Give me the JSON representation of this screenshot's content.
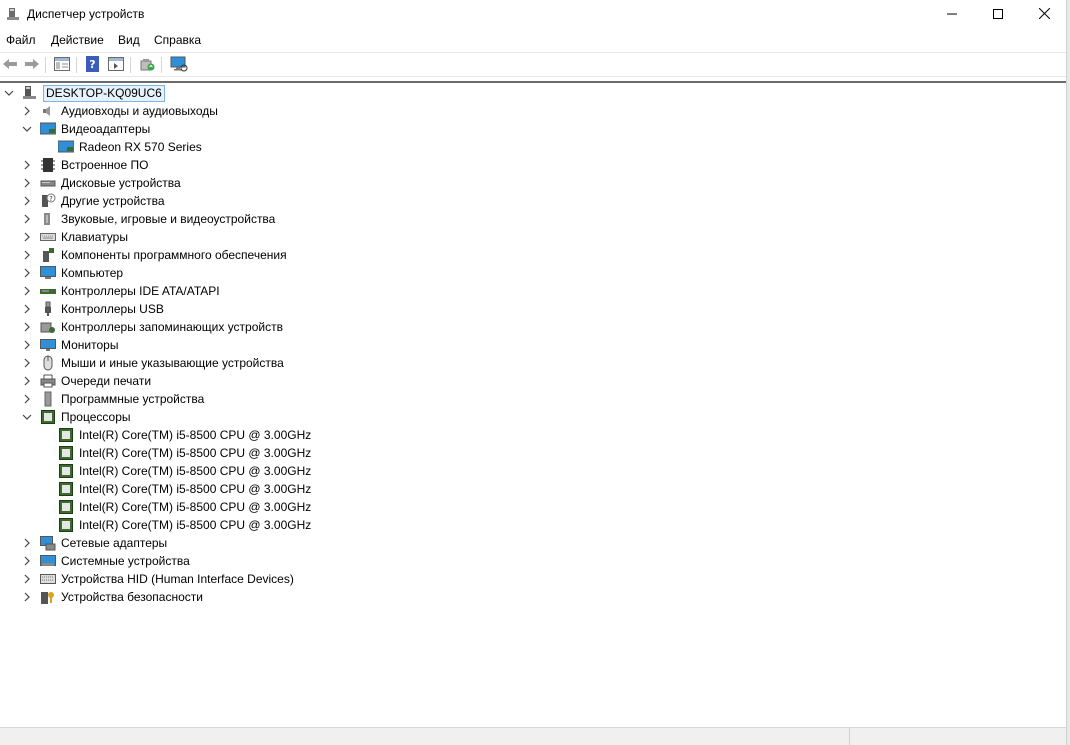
{
  "window": {
    "title": "Диспетчер устройств",
    "minimize_icon": "minimize-icon",
    "maximize_icon": "maximize-icon",
    "close_icon": "close-icon"
  },
  "menu": [
    "Файл",
    "Действие",
    "Вид",
    "Справка"
  ],
  "toolbar": {
    "buttons": [
      "back-arrow-icon",
      "forward-arrow-icon",
      "properties-pane-icon",
      "help-icon",
      "show-hide-console-tree-icon",
      "update-driver-icon",
      "scan-hardware-changes-icon"
    ]
  },
  "tree": {
    "root": "DESKTOP-KQ09UC6",
    "categories": [
      {
        "label": "Аудиовходы и аудиовыходы",
        "expanded": false,
        "icon": "audio-io-icon",
        "children": []
      },
      {
        "label": "Видеоадаптеры",
        "expanded": true,
        "icon": "display-adapter-icon",
        "children": [
          "Radeon RX 570 Series"
        ]
      },
      {
        "label": "Встроенное ПО",
        "expanded": false,
        "icon": "firmware-icon",
        "children": []
      },
      {
        "label": "Дисковые устройства",
        "expanded": false,
        "icon": "disk-drive-icon",
        "children": []
      },
      {
        "label": "Другие устройства",
        "expanded": false,
        "icon": "other-devices-icon",
        "children": []
      },
      {
        "label": "Звуковые, игровые и видеоустройства",
        "expanded": false,
        "icon": "speaker-icon",
        "children": []
      },
      {
        "label": "Клавиатуры",
        "expanded": false,
        "icon": "keyboard-icon",
        "children": []
      },
      {
        "label": "Компоненты программного обеспечения",
        "expanded": false,
        "icon": "software-component-icon",
        "children": []
      },
      {
        "label": "Компьютер",
        "expanded": false,
        "icon": "computer-icon",
        "children": []
      },
      {
        "label": "Контроллеры IDE ATA/ATAPI",
        "expanded": false,
        "icon": "ide-controller-icon",
        "children": []
      },
      {
        "label": "Контроллеры USB",
        "expanded": false,
        "icon": "usb-icon",
        "children": []
      },
      {
        "label": "Контроллеры запоминающих устройств",
        "expanded": false,
        "icon": "storage-controller-icon",
        "children": []
      },
      {
        "label": "Мониторы",
        "expanded": false,
        "icon": "monitor-icon",
        "children": []
      },
      {
        "label": "Мыши и иные указывающие устройства",
        "expanded": false,
        "icon": "mouse-icon",
        "children": []
      },
      {
        "label": "Очереди печати",
        "expanded": false,
        "icon": "printer-icon",
        "children": []
      },
      {
        "label": "Программные устройства",
        "expanded": false,
        "icon": "software-device-icon",
        "children": []
      },
      {
        "label": "Процессоры",
        "expanded": true,
        "icon": "processor-icon",
        "children": [
          "Intel(R) Core(TM) i5-8500 CPU @ 3.00GHz",
          "Intel(R) Core(TM) i5-8500 CPU @ 3.00GHz",
          "Intel(R) Core(TM) i5-8500 CPU @ 3.00GHz",
          "Intel(R) Core(TM) i5-8500 CPU @ 3.00GHz",
          "Intel(R) Core(TM) i5-8500 CPU @ 3.00GHz",
          "Intel(R) Core(TM) i5-8500 CPU @ 3.00GHz"
        ]
      },
      {
        "label": "Сетевые адаптеры",
        "expanded": false,
        "icon": "network-adapter-icon",
        "children": []
      },
      {
        "label": "Системные устройства",
        "expanded": false,
        "icon": "system-device-icon",
        "children": []
      },
      {
        "label": "Устройства HID (Human Interface Devices)",
        "expanded": false,
        "icon": "hid-icon",
        "children": []
      },
      {
        "label": "Устройства безопасности",
        "expanded": false,
        "icon": "security-device-icon",
        "children": []
      }
    ]
  },
  "colors": {
    "selection_border": "#7eb4ea",
    "selection_fill": "#e5f1fb",
    "monitor_blue": "#2f8fd8",
    "chip_green": "#3c6b2e"
  }
}
